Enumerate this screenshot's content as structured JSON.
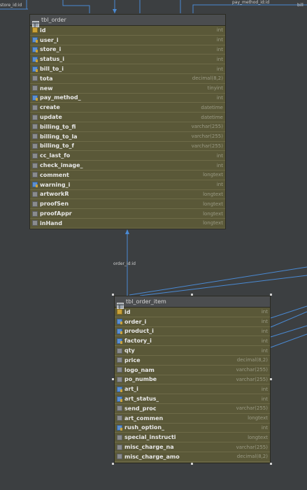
{
  "labels": {
    "store_id": "store_id:id",
    "pay_method": "pay_method_id:id",
    "bill": "bill",
    "order_id": "order_id:id"
  },
  "tbl_order": {
    "title": "tbl_order",
    "columns": [
      {
        "name": "id",
        "type": "int",
        "key": "pk"
      },
      {
        "name": "user_i",
        "type": "int",
        "key": "fk"
      },
      {
        "name": "store_i",
        "type": "int",
        "key": "fk"
      },
      {
        "name": "status_i",
        "type": "int",
        "key": "fk"
      },
      {
        "name": "bill_to_i",
        "type": "int",
        "key": "fk"
      },
      {
        "name": "tota",
        "type": "decimal(8,2)",
        "key": "plain"
      },
      {
        "name": "new",
        "type": "tinyint",
        "key": "plain"
      },
      {
        "name": "pay_method_",
        "type": "int",
        "key": "fk"
      },
      {
        "name": "create",
        "type": "datetime",
        "key": "plain"
      },
      {
        "name": "update",
        "type": "datetime",
        "key": "plain"
      },
      {
        "name": "billing_to_fi",
        "type": "varchar(255)",
        "key": "plain"
      },
      {
        "name": "billing_to_la",
        "type": "varchar(255)",
        "key": "plain"
      },
      {
        "name": "billing_to_f",
        "type": "varchar(255)",
        "key": "plain"
      },
      {
        "name": "cc_last_fo",
        "type": "int",
        "key": "plain"
      },
      {
        "name": "check_image_",
        "type": "int",
        "key": "plain"
      },
      {
        "name": "comment",
        "type": "longtext",
        "key": "plain"
      },
      {
        "name": "warning_i",
        "type": "int",
        "key": "fk"
      },
      {
        "name": "artworkR",
        "type": "longtext",
        "key": "plain"
      },
      {
        "name": "proofSen",
        "type": "longtext",
        "key": "plain"
      },
      {
        "name": "proofAppr",
        "type": "longtext",
        "key": "plain"
      },
      {
        "name": "inHand",
        "type": "longtext",
        "key": "plain"
      }
    ]
  },
  "tbl_order_item": {
    "title": "tbl_order_item",
    "columns": [
      {
        "name": "id",
        "type": "int",
        "key": "pk"
      },
      {
        "name": "order_i",
        "type": "int",
        "key": "fk"
      },
      {
        "name": "product_i",
        "type": "int",
        "key": "fk"
      },
      {
        "name": "factory_i",
        "type": "int",
        "key": "fk"
      },
      {
        "name": "qty",
        "type": "int",
        "key": "plain"
      },
      {
        "name": "price",
        "type": "decimal(8,2)",
        "key": "plain"
      },
      {
        "name": "logo_nam",
        "type": "varchar(255)",
        "key": "plain"
      },
      {
        "name": "po_numbe",
        "type": "varchar(255)",
        "key": "plain"
      },
      {
        "name": "art_i",
        "type": "int",
        "key": "fk"
      },
      {
        "name": "art_status_",
        "type": "int",
        "key": "fk"
      },
      {
        "name": "send_proc",
        "type": "varchar(255)",
        "key": "plain"
      },
      {
        "name": "art_commen",
        "type": "longtext",
        "key": "plain"
      },
      {
        "name": "rush_option_",
        "type": "int",
        "key": "fk"
      },
      {
        "name": "special_instructi",
        "type": "longtext",
        "key": "plain"
      },
      {
        "name": "misc_charge_na",
        "type": "varchar(255)",
        "key": "plain"
      },
      {
        "name": "misc_charge_amo",
        "type": "decimal(8,2)",
        "key": "plain"
      }
    ]
  }
}
